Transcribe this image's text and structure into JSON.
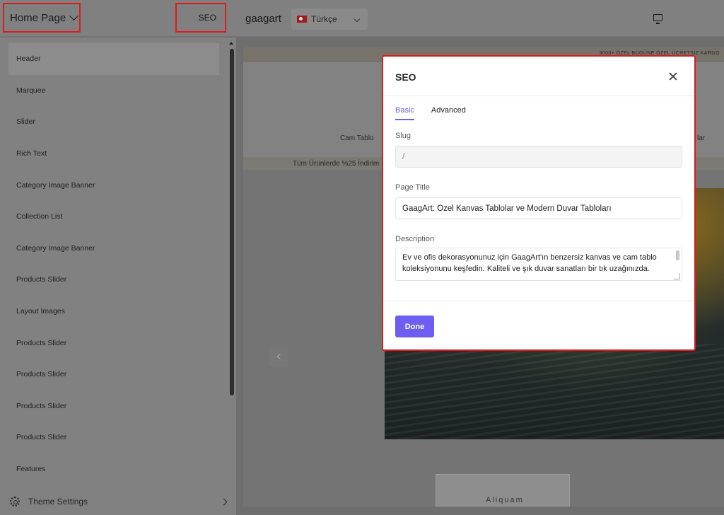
{
  "topbar": {
    "page_select": "Home Page",
    "seo_button": "SEO",
    "store_name": "gaagart",
    "language": "Türkçe"
  },
  "sidebar": {
    "items": [
      "Header",
      "Marquee",
      "Slider",
      "Rich Text",
      "Category Image Banner",
      "Collection List",
      "Category Image Banner",
      "Products Slider",
      "Layout Images",
      "Products Slider",
      "Products Slider",
      "Products Slider",
      "Products Slider",
      "Features"
    ],
    "theme_settings": "Theme Settings"
  },
  "preview": {
    "top_strip": "3000+ ÖZEL BUGÜNE ÖZEL ÜCRETSİZ KARGO",
    "nav_left": "Cam Tablo",
    "nav_right": "lar",
    "announcement": "Tüm Ürünlerde %25 İndirim",
    "product_label": "Aliquam"
  },
  "modal": {
    "title": "SEO",
    "tabs": [
      "Basic",
      "Advanced"
    ],
    "slug_label": "Slug",
    "slug_value": "/",
    "page_title_label": "Page Title",
    "page_title_value": "GaagArt: Özel Kanvas Tablolar ve Modern Duvar Tabloları",
    "description_label": "Description",
    "description_value": "Ev ve ofis dekorasyonunuz için GaagArt'ın benzersiz kanvas ve cam tablo koleksiyonunu keşfedin. Kaliteli ve şık duvar sanatları bir tık uzağınızda.",
    "done_button": "Done"
  },
  "colors": {
    "accent": "#6d5df0",
    "highlight_border": "#e0191f"
  }
}
